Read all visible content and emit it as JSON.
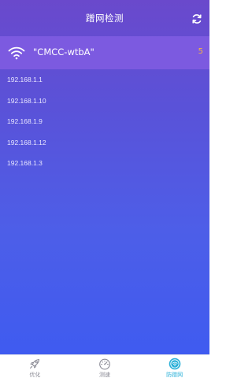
{
  "header": {
    "title": "蹭网检测",
    "refresh_icon": "refresh-icon"
  },
  "network": {
    "ssid": "\"CMCC-wtbA\"",
    "device_count": "5",
    "icon": "wifi-icon"
  },
  "devices": [
    "192.168.1.1",
    "192.168.1.10",
    "192.168.1.9",
    "192.168.1.12",
    "192.168.1.3"
  ],
  "tabs": [
    {
      "label": "优化",
      "icon": "rocket-icon",
      "active": false
    },
    {
      "label": "测速",
      "icon": "speedometer-icon",
      "active": false
    },
    {
      "label": "防蹭网",
      "icon": "shield-wifi-icon",
      "active": true
    }
  ],
  "colors": {
    "accent": "#2ab0d8",
    "count": "#f5b342",
    "gradient_top": "#6a49cc",
    "gradient_bottom": "#3f5bf0"
  }
}
